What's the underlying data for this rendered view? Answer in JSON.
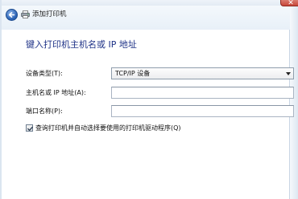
{
  "window": {
    "title": "添加打印机",
    "close_glyph": "✕"
  },
  "heading": "键入打印机主机名或 IP 地址",
  "form": {
    "device_type_label": "设备类型(T):",
    "device_type_value": "TCP/IP 设备",
    "hostname_label": "主机名或 IP 地址(A):",
    "hostname_value": "",
    "port_label": "端口名称(P):",
    "port_value": "",
    "query_label": "查询打印机并自动选择要使用的打印机驱动程序(Q)",
    "query_checked": true
  },
  "icons": {
    "back": "back-arrow-icon",
    "printer": "printer-icon",
    "dropdown": "chevron-down-icon",
    "check": "checkmark-icon"
  }
}
